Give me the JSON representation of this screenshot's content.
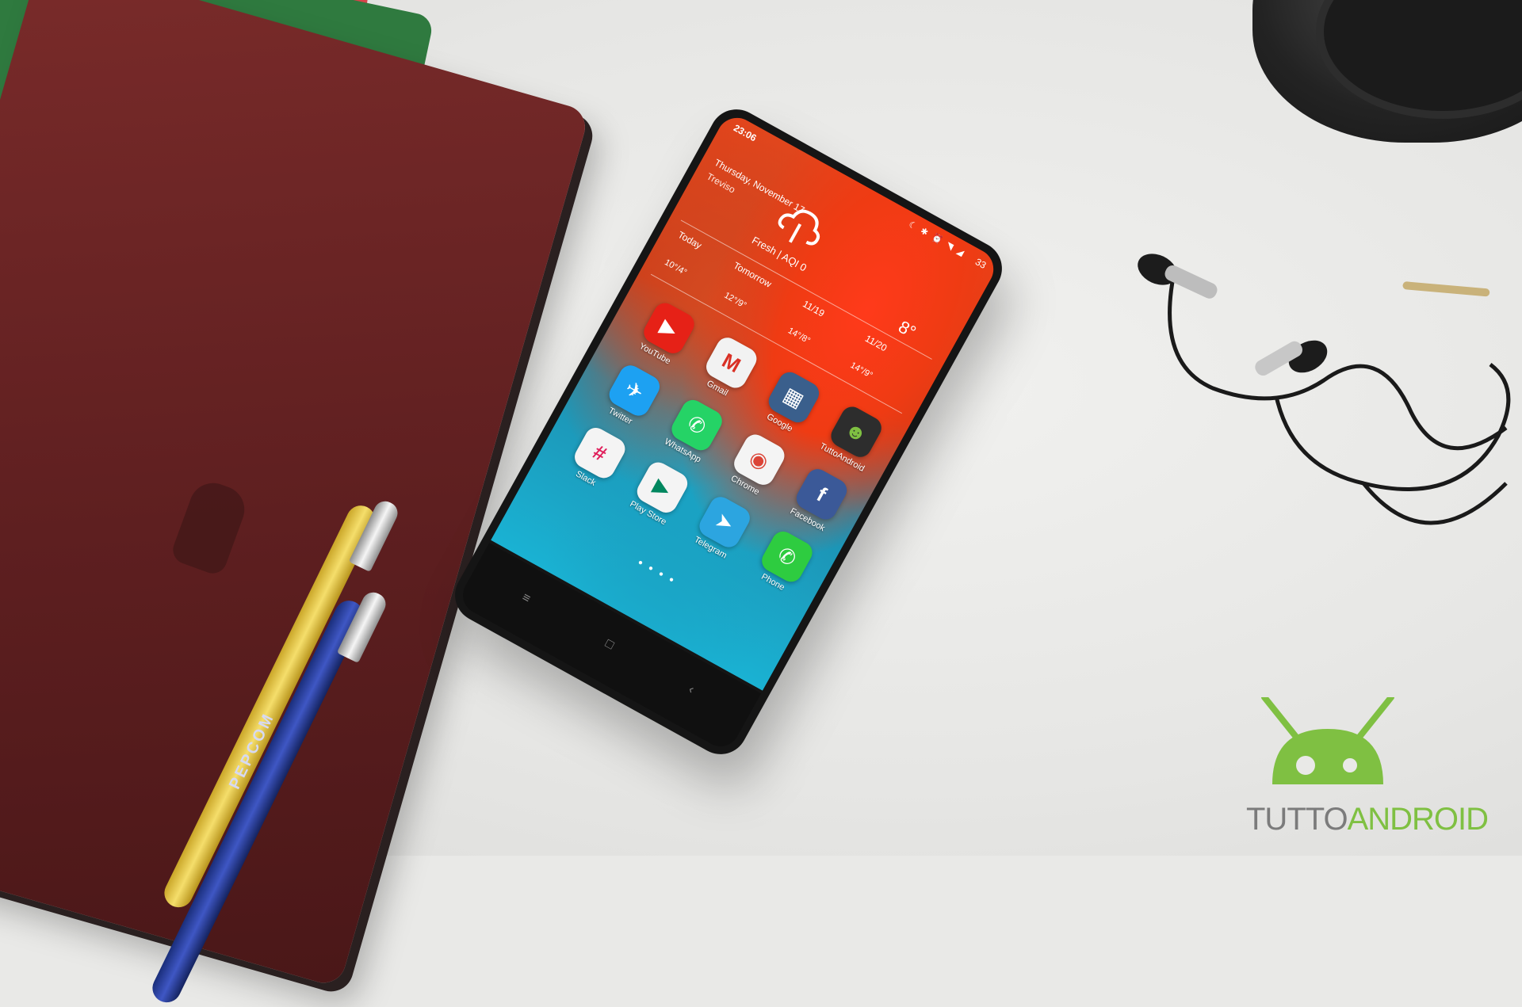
{
  "scene": {
    "description_icons": [
      "notebook-icon",
      "pen-icon",
      "camera-lens-icon",
      "earphones-icon",
      "smartphone-icon"
    ]
  },
  "phone": {
    "status": {
      "time": "23:06",
      "battery": "33"
    },
    "weather": {
      "date": "Thursday, November 17",
      "city": "Treviso",
      "aqi": "Fresh | AQI 0",
      "current_temp": "8°",
      "days": [
        {
          "label": "Today",
          "temp": "10°/4°"
        },
        {
          "label": "Tomorrow",
          "temp": "12°/9°"
        },
        {
          "label": "11/19",
          "temp": "14°/8°"
        },
        {
          "label": "11/20",
          "temp": "14°/9°"
        }
      ]
    },
    "apps": [
      {
        "label": "YouTube",
        "color": "#e62117",
        "glyph": "▶"
      },
      {
        "label": "Gmail",
        "color": "#f2f2f2",
        "glyph": "M"
      },
      {
        "label": "Google",
        "color": "#3a5f8c",
        "glyph": "▦"
      },
      {
        "label": "TuttoAndroid",
        "color": "#2d2d2d",
        "glyph": "☻"
      },
      {
        "label": "Twitter",
        "color": "#1da1f2",
        "glyph": "✈"
      },
      {
        "label": "WhatsApp",
        "color": "#25d366",
        "glyph": "✆"
      },
      {
        "label": "Chrome",
        "color": "#f4f4f4",
        "glyph": "◉"
      },
      {
        "label": "Facebook",
        "color": "#3b5998",
        "glyph": "f"
      },
      {
        "label": "Slack",
        "color": "#f4f4f4",
        "glyph": "#"
      },
      {
        "label": "Play Store",
        "color": "#f4f4f4",
        "glyph": "▶"
      },
      {
        "label": "Telegram",
        "color": "#2ca5e0",
        "glyph": "➤"
      },
      {
        "label": "Phone",
        "color": "#2ecc40",
        "glyph": "✆"
      }
    ],
    "nav": {
      "menu": "≡",
      "home": "□",
      "back": "‹"
    }
  },
  "pen_brand": "PEPCOM",
  "logo": {
    "part1": "TUTTO",
    "part2": "ANDROID",
    "green": "#7fc042",
    "gray": "#7b7b7b"
  }
}
